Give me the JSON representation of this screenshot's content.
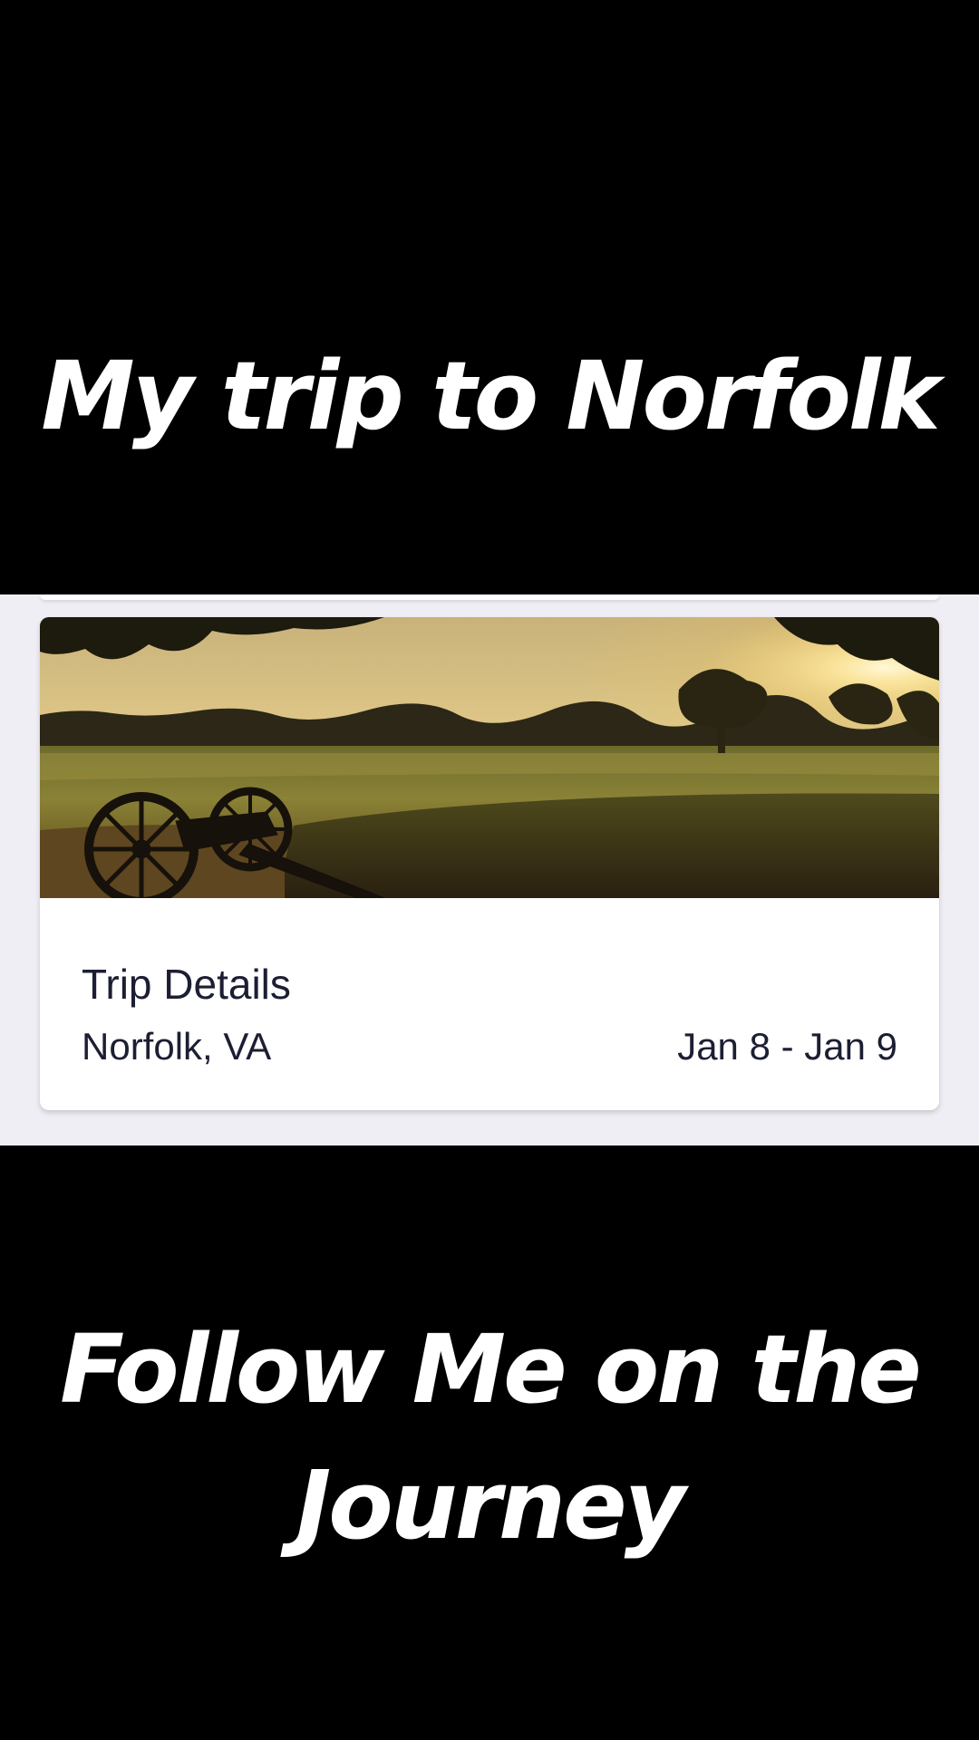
{
  "captions": {
    "top": "My trip to Norfolk",
    "bottom_line1": "Follow Me on the",
    "bottom_line2": "Journey"
  },
  "trip_card": {
    "image": "battlefield-sunset-with-cannon-photo",
    "title": "Trip Details",
    "location": "Norfolk, VA",
    "dates": "Jan 8 - Jan 9"
  },
  "colors": {
    "background": "#000000",
    "caption_text": "#ffffff",
    "app_background": "#efeef4",
    "card_background": "#ffffff",
    "card_text": "#1c1f33"
  }
}
